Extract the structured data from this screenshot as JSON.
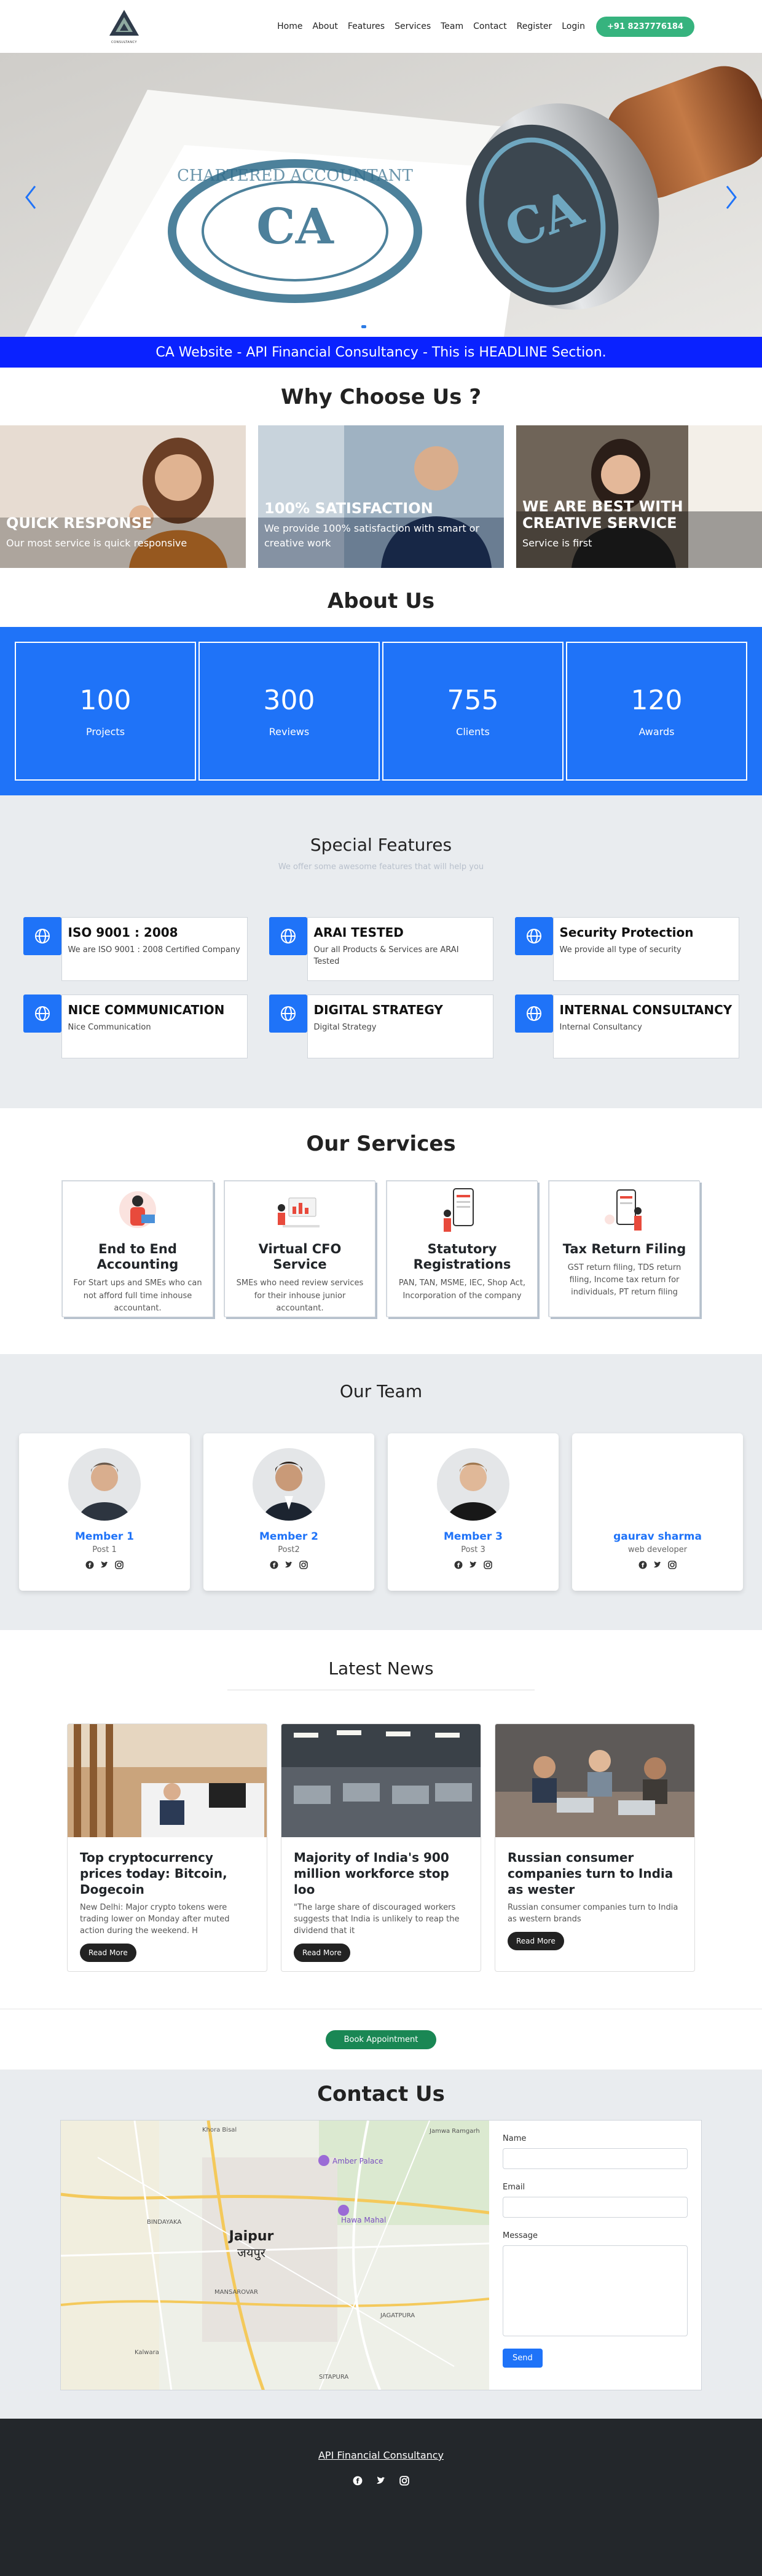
{
  "nav": {
    "logo_text": "CONSULTANCY",
    "links": [
      "Home",
      "About",
      "Features",
      "Services",
      "Team",
      "Contact",
      "Register",
      "Login"
    ],
    "phone": "+91 8237776184"
  },
  "hero": {
    "stamp_text": "CA",
    "ring_text": "CHARTERED ACCOUNTANT",
    "slide_count": 5,
    "active_slide": 1
  },
  "headline": "CA Website - API Financial Consultancy - This is HEADLINE Section.",
  "why": {
    "title": "Why Choose Us ?",
    "cards": [
      {
        "title": "QUICK RESPONSE",
        "text": "Our most service is quick responsive"
      },
      {
        "title": "100% SATISFACTION",
        "text": "We provide 100% satisfaction with smart or creative work"
      },
      {
        "title": "WE ARE BEST WITH CREATIVE SERVICE",
        "text": "Service is first"
      }
    ]
  },
  "about": {
    "title": "About Us",
    "stats": [
      {
        "value": "100",
        "label": "Projects"
      },
      {
        "value": "300",
        "label": "Reviews"
      },
      {
        "value": "755",
        "label": "Clients"
      },
      {
        "value": "120",
        "label": "Awards"
      }
    ]
  },
  "features": {
    "title": "Special Features",
    "subtitle": "We offer some awesome features that will help you",
    "items": [
      {
        "title": "ISO 9001 : 2008",
        "text": "We are ISO 9001 : 2008 Certified Company"
      },
      {
        "title": "ARAI TESTED",
        "text": "Our all Products & Services are ARAI Tested"
      },
      {
        "title": "Security Protection",
        "text": "We provide all type of security"
      },
      {
        "title": "NICE COMMUNICATION",
        "text": "Nice Communication"
      },
      {
        "title": "DIGITAL STRATEGY",
        "text": "Digital Strategy"
      },
      {
        "title": "INTERNAL CONSULTANCY",
        "text": "Internal Consultancy"
      }
    ]
  },
  "services": {
    "title": "Our Services",
    "items": [
      {
        "title": "End to End Accounting",
        "text": "For Start ups and SMEs who can not afford full time inhouse accountant."
      },
      {
        "title": "Virtual CFO Service",
        "text": "SMEs who need review services for their inhouse junior accountant."
      },
      {
        "title": "Statutory Registrations",
        "text": "PAN, TAN, MSME, IEC, Shop Act, Incorporation of the company"
      },
      {
        "title": "Tax Return Filing",
        "text": "GST return filing, TDS return filing, Income tax return for individuals, PT return filing"
      }
    ]
  },
  "team": {
    "title": "Our Team",
    "members": [
      {
        "name": "Member 1",
        "post": "Post 1"
      },
      {
        "name": "Member 2",
        "post": "Post2"
      },
      {
        "name": "Member 3",
        "post": "Post 3"
      },
      {
        "name": "gaurav sharma",
        "post": "web developer"
      }
    ]
  },
  "news": {
    "title": "Latest News",
    "items": [
      {
        "title": "Top cryptocurrency prices today: Bitcoin, Dogecoin",
        "text": "New Delhi: Major crypto tokens were trading lower on Monday after muted action during the weekend. H",
        "button": "Read More"
      },
      {
        "title": "Majority of India's 900 million workforce stop loo",
        "text": "\"The large share of discouraged workers suggests that India is unlikely to reap the dividend that it",
        "button": "Read More"
      },
      {
        "title": "Russian consumer companies turn to India as wester",
        "text": "Russian consumer companies turn to India as western brands",
        "button": "Read More"
      }
    ]
  },
  "appointment": {
    "button": "Book Appointment"
  },
  "contact": {
    "title": "Contact Us",
    "map_city": "Jaipur",
    "map_city_local": "जयपुर",
    "map_labels": [
      "Amber Palace",
      "Hawa Mahal",
      "BINDAYAKA",
      "SITAPURA",
      "MANSAROVAR",
      "JAGATPURA",
      "Kalwara",
      "Khora Bisal",
      "Jamwa Ramgarh"
    ],
    "form": {
      "name_label": "Name",
      "email_label": "Email",
      "message_label": "Message",
      "send": "Send"
    }
  },
  "footer": {
    "link": "API Financial Consultancy"
  }
}
